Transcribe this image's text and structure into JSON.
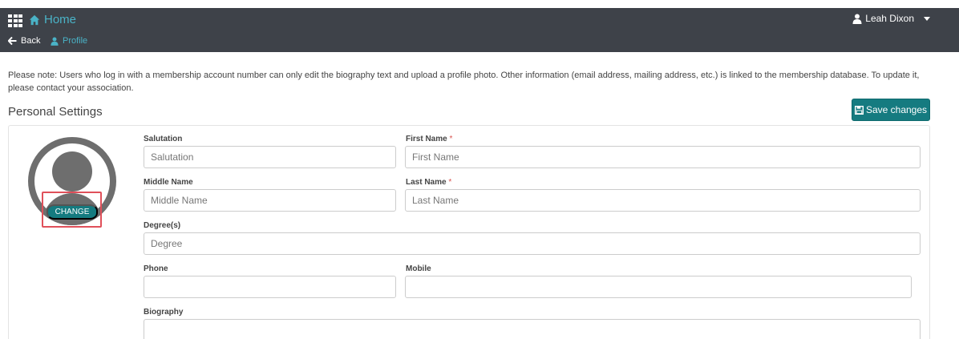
{
  "header": {
    "home_label": "Home",
    "back_label": "Back",
    "profile_label": "Profile",
    "user_name": "Leah Dixon"
  },
  "note": "Please note: Users who log in with a membership account number can only edit the biography text and upload a profile photo. Other information (email address, mailing address, etc.) is linked to the membership database. To update it, please contact your association.",
  "section_title": "Personal Settings",
  "save_label": "Save changes",
  "avatar": {
    "change_label": "CHANGE"
  },
  "form": {
    "salutation": {
      "label": "Salutation",
      "placeholder": "Salutation",
      "value": ""
    },
    "first_name": {
      "label": "First Name",
      "required_mark": "*",
      "placeholder": "First Name",
      "value": ""
    },
    "middle_name": {
      "label": "Middle Name",
      "placeholder": "Middle Name",
      "value": ""
    },
    "last_name": {
      "label": "Last Name",
      "required_mark": "*",
      "placeholder": "Last Name",
      "value": ""
    },
    "degree": {
      "label": "Degree(s)",
      "placeholder": "Degree",
      "value": ""
    },
    "phone": {
      "label": "Phone",
      "placeholder": "",
      "value": ""
    },
    "mobile": {
      "label": "Mobile",
      "placeholder": "",
      "value": ""
    },
    "biography": {
      "label": "Biography",
      "placeholder": "",
      "value": ""
    }
  },
  "colors": {
    "topbar": "#3e4249",
    "accent": "#157b80",
    "link": "#4ab3c7",
    "highlight": "#e0505a",
    "required": "#d9534f"
  },
  "icons": {
    "apps": "grid-icon",
    "home": "home-icon",
    "user": "user-icon",
    "dropdown": "caret-icon",
    "back": "arrow-left-icon",
    "profile": "user-icon",
    "save": "floppy-disk-icon"
  }
}
